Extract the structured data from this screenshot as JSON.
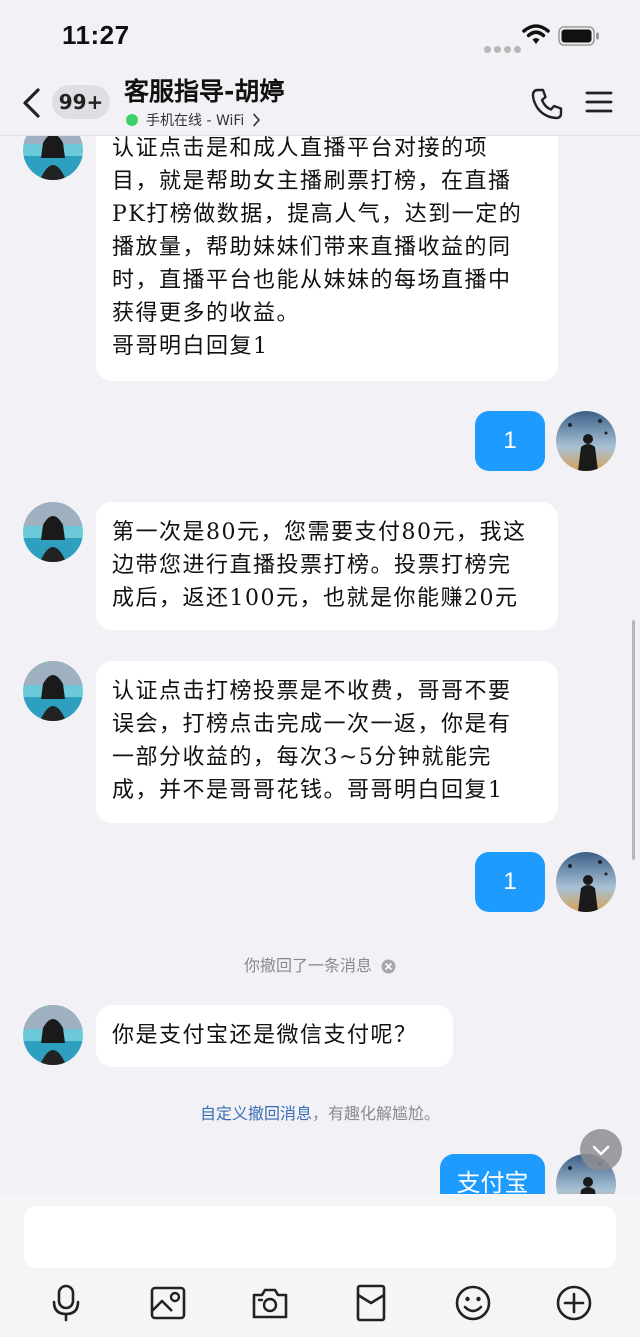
{
  "status_bar": {
    "time": "11:27"
  },
  "nav": {
    "unread_count": "99+",
    "contact_name": "客服指导-胡婷",
    "online_status": "手机在线 - WiFi"
  },
  "messages": {
    "m1": [
      "认证点击是和成人直播平台对接的项",
      "目，就是帮助女主播刷票打榜，在直播",
      "PK打榜做数据，提高人气，达到一定的",
      "播放量，帮助妹妹们带来直播收益的同",
      "时，直播平台也能从妹妹的每场直播中",
      "获得更多的收益。",
      "哥哥明白回复1"
    ],
    "m2": "1",
    "m3": [
      "第一次是80元，您需要支付80元，我这",
      "边带您进行直播投票打榜。投票打榜完",
      "成后，返还100元，也就是你能赚20元"
    ],
    "m4": [
      "认证点击打榜投票是不收费，哥哥不要",
      "误会，打榜点击完成一次一返，你是有",
      "一部分收益的，每次3~5分钟就能完",
      "成，并不是哥哥花钱。哥哥明白回复1"
    ],
    "m5": "1",
    "recall_notice": "你撤回了一条消息",
    "m6": "你是支付宝还是微信支付呢？",
    "tip_link": "自定义撤回消息",
    "tip_rest": "，有趣化解尴尬。",
    "m7": "支付宝"
  },
  "input": {
    "placeholder": ""
  },
  "toolbar": {
    "icons": [
      "microphone-icon",
      "image-icon",
      "camera-icon",
      "red-packet-icon",
      "emoji-icon",
      "plus-icon"
    ]
  },
  "colors": {
    "background": "#f2f2f6",
    "bubble_outgoing": "#1e9bff",
    "bubble_incoming": "#ffffff",
    "online_dot": "#3fcf6b",
    "link": "#3a6fb5"
  }
}
